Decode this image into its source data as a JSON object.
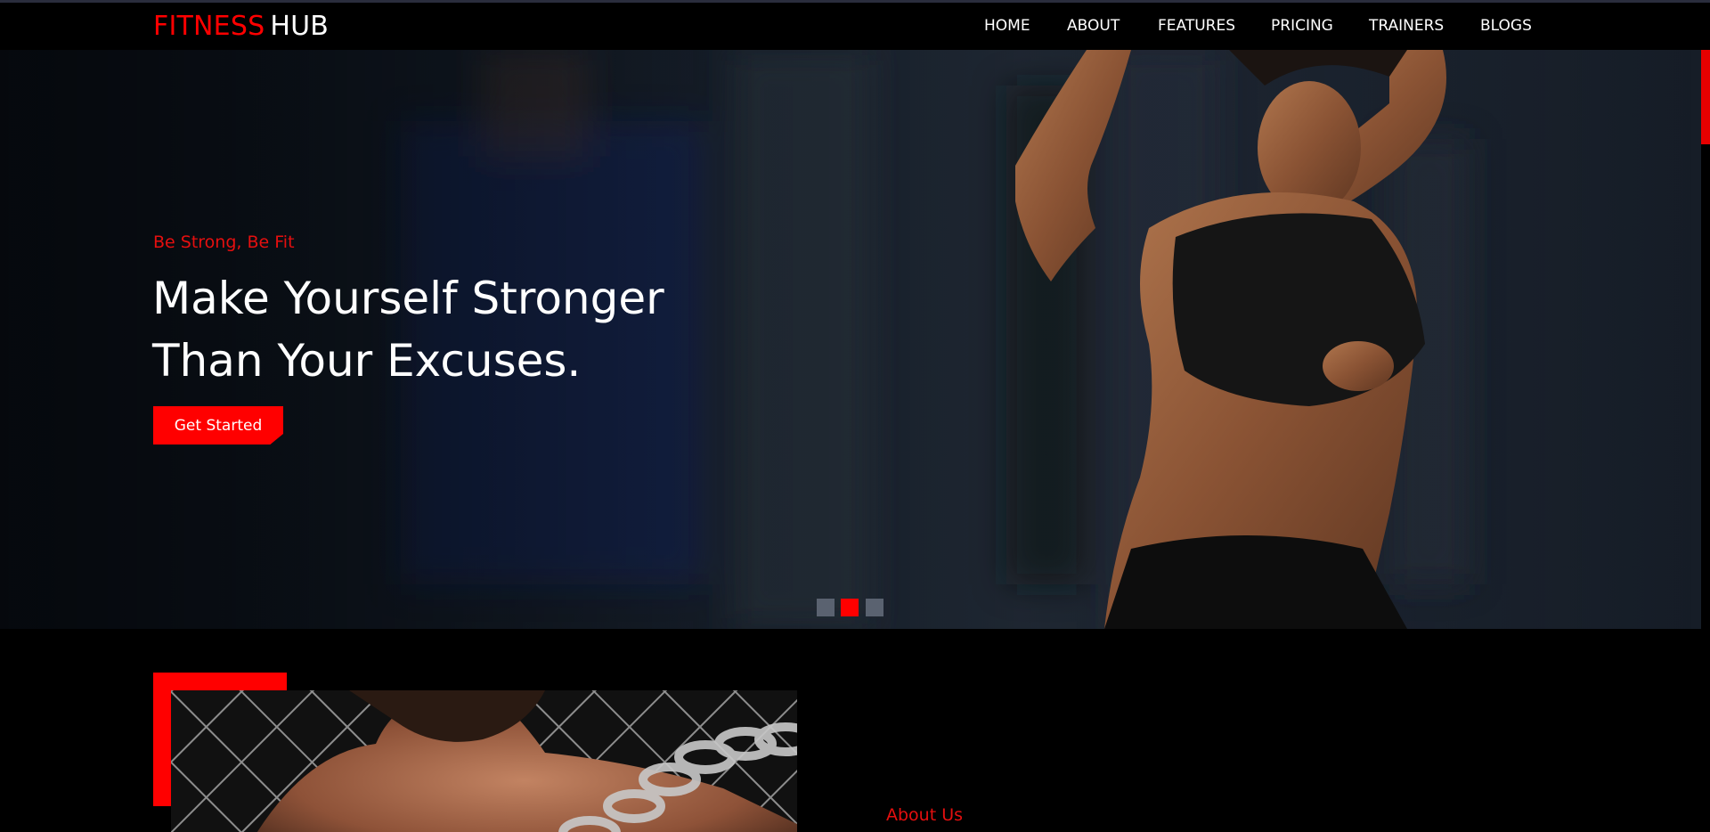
{
  "brand": {
    "part1": "FITNESS",
    "part2": "HUB"
  },
  "nav": {
    "items": [
      {
        "label": "HOME"
      },
      {
        "label": "ABOUT"
      },
      {
        "label": "FEATURES"
      },
      {
        "label": "PRICING"
      },
      {
        "label": "TRAINERS"
      },
      {
        "label": "BLOGS"
      }
    ]
  },
  "hero": {
    "tagline": "Be Strong, Be Fit",
    "headline_line1": "Make Yourself Stronger",
    "headline_line2": "Than Your Excuses.",
    "cta_label": "Get Started",
    "slider": {
      "slide_count": 3,
      "active_index": 1
    }
  },
  "about": {
    "label": "About Us"
  },
  "colors": {
    "accent": "#ff0000",
    "background": "#000000",
    "text": "#ffffff"
  }
}
